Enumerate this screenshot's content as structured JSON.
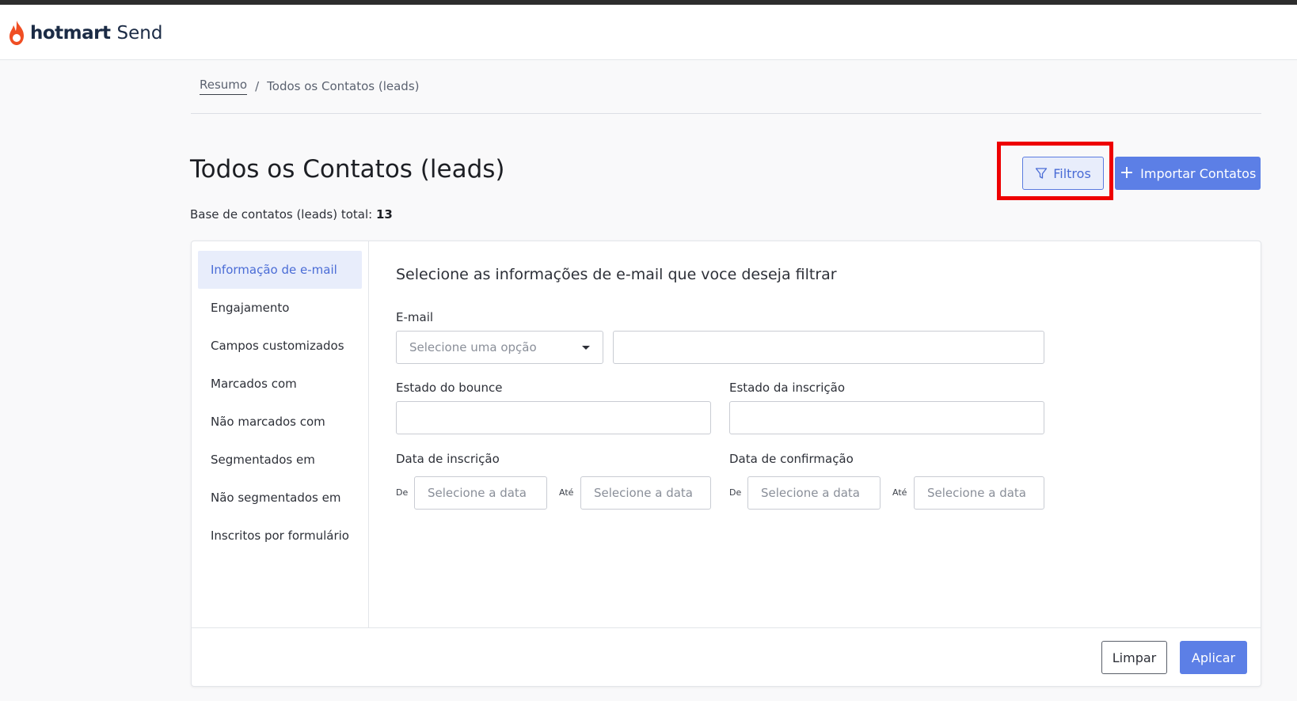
{
  "header": {
    "brand": "hotmart",
    "product": "Send"
  },
  "breadcrumb": {
    "home": "Resumo",
    "separator": "/",
    "current": "Todos os Contatos (leads)"
  },
  "page": {
    "title": "Todos os Contatos (leads)",
    "total_label": "Base de contatos (leads) total:",
    "total_value": "13"
  },
  "actions": {
    "filter_label": "Filtros",
    "import_label": "Importar Contatos"
  },
  "sidebar": {
    "items": [
      {
        "label": "Informação de e-mail",
        "active": true
      },
      {
        "label": "Engajamento"
      },
      {
        "label": "Campos customizados"
      },
      {
        "label": "Marcados com"
      },
      {
        "label": "Não marcados com"
      },
      {
        "label": "Segmentados em"
      },
      {
        "label": "Não segmentados em"
      },
      {
        "label": "Inscritos por formulário"
      }
    ]
  },
  "form": {
    "title": "Selecione as informações de e-mail que voce deseja filtrar",
    "email_label": "E-mail",
    "email_operator_placeholder": "Selecione uma opção",
    "email_value": "",
    "bounce_label": "Estado do bounce",
    "bounce_value": "",
    "subscription_state_label": "Estado da inscrição",
    "subscription_state_value": "",
    "subscription_date_label": "Data de inscrição",
    "confirmation_date_label": "Data de confirmação",
    "from_label": "De",
    "to_label": "Até",
    "date_placeholder": "Selecione a data"
  },
  "footer": {
    "clear_label": "Limpar",
    "apply_label": "Aplicar"
  },
  "colors": {
    "accent": "#5c7fe6",
    "highlight": "#ee0000",
    "logo_flame": "#f04e23"
  }
}
